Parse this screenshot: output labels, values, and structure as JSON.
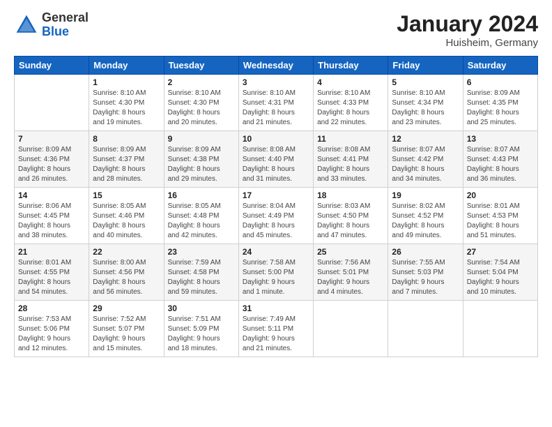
{
  "header": {
    "logo_general": "General",
    "logo_blue": "Blue",
    "main_title": "January 2024",
    "subtitle": "Huisheim, Germany"
  },
  "columns": [
    "Sunday",
    "Monday",
    "Tuesday",
    "Wednesday",
    "Thursday",
    "Friday",
    "Saturday"
  ],
  "rows": [
    [
      {
        "day": "",
        "info": ""
      },
      {
        "day": "1",
        "info": "Sunrise: 8:10 AM\nSunset: 4:30 PM\nDaylight: 8 hours\nand 19 minutes."
      },
      {
        "day": "2",
        "info": "Sunrise: 8:10 AM\nSunset: 4:30 PM\nDaylight: 8 hours\nand 20 minutes."
      },
      {
        "day": "3",
        "info": "Sunrise: 8:10 AM\nSunset: 4:31 PM\nDaylight: 8 hours\nand 21 minutes."
      },
      {
        "day": "4",
        "info": "Sunrise: 8:10 AM\nSunset: 4:33 PM\nDaylight: 8 hours\nand 22 minutes."
      },
      {
        "day": "5",
        "info": "Sunrise: 8:10 AM\nSunset: 4:34 PM\nDaylight: 8 hours\nand 23 minutes."
      },
      {
        "day": "6",
        "info": "Sunrise: 8:09 AM\nSunset: 4:35 PM\nDaylight: 8 hours\nand 25 minutes."
      }
    ],
    [
      {
        "day": "7",
        "info": "Sunrise: 8:09 AM\nSunset: 4:36 PM\nDaylight: 8 hours\nand 26 minutes."
      },
      {
        "day": "8",
        "info": "Sunrise: 8:09 AM\nSunset: 4:37 PM\nDaylight: 8 hours\nand 28 minutes."
      },
      {
        "day": "9",
        "info": "Sunrise: 8:09 AM\nSunset: 4:38 PM\nDaylight: 8 hours\nand 29 minutes."
      },
      {
        "day": "10",
        "info": "Sunrise: 8:08 AM\nSunset: 4:40 PM\nDaylight: 8 hours\nand 31 minutes."
      },
      {
        "day": "11",
        "info": "Sunrise: 8:08 AM\nSunset: 4:41 PM\nDaylight: 8 hours\nand 33 minutes."
      },
      {
        "day": "12",
        "info": "Sunrise: 8:07 AM\nSunset: 4:42 PM\nDaylight: 8 hours\nand 34 minutes."
      },
      {
        "day": "13",
        "info": "Sunrise: 8:07 AM\nSunset: 4:43 PM\nDaylight: 8 hours\nand 36 minutes."
      }
    ],
    [
      {
        "day": "14",
        "info": "Sunrise: 8:06 AM\nSunset: 4:45 PM\nDaylight: 8 hours\nand 38 minutes."
      },
      {
        "day": "15",
        "info": "Sunrise: 8:05 AM\nSunset: 4:46 PM\nDaylight: 8 hours\nand 40 minutes."
      },
      {
        "day": "16",
        "info": "Sunrise: 8:05 AM\nSunset: 4:48 PM\nDaylight: 8 hours\nand 42 minutes."
      },
      {
        "day": "17",
        "info": "Sunrise: 8:04 AM\nSunset: 4:49 PM\nDaylight: 8 hours\nand 45 minutes."
      },
      {
        "day": "18",
        "info": "Sunrise: 8:03 AM\nSunset: 4:50 PM\nDaylight: 8 hours\nand 47 minutes."
      },
      {
        "day": "19",
        "info": "Sunrise: 8:02 AM\nSunset: 4:52 PM\nDaylight: 8 hours\nand 49 minutes."
      },
      {
        "day": "20",
        "info": "Sunrise: 8:01 AM\nSunset: 4:53 PM\nDaylight: 8 hours\nand 51 minutes."
      }
    ],
    [
      {
        "day": "21",
        "info": "Sunrise: 8:01 AM\nSunset: 4:55 PM\nDaylight: 8 hours\nand 54 minutes."
      },
      {
        "day": "22",
        "info": "Sunrise: 8:00 AM\nSunset: 4:56 PM\nDaylight: 8 hours\nand 56 minutes."
      },
      {
        "day": "23",
        "info": "Sunrise: 7:59 AM\nSunset: 4:58 PM\nDaylight: 8 hours\nand 59 minutes."
      },
      {
        "day": "24",
        "info": "Sunrise: 7:58 AM\nSunset: 5:00 PM\nDaylight: 9 hours\nand 1 minute."
      },
      {
        "day": "25",
        "info": "Sunrise: 7:56 AM\nSunset: 5:01 PM\nDaylight: 9 hours\nand 4 minutes."
      },
      {
        "day": "26",
        "info": "Sunrise: 7:55 AM\nSunset: 5:03 PM\nDaylight: 9 hours\nand 7 minutes."
      },
      {
        "day": "27",
        "info": "Sunrise: 7:54 AM\nSunset: 5:04 PM\nDaylight: 9 hours\nand 10 minutes."
      }
    ],
    [
      {
        "day": "28",
        "info": "Sunrise: 7:53 AM\nSunset: 5:06 PM\nDaylight: 9 hours\nand 12 minutes."
      },
      {
        "day": "29",
        "info": "Sunrise: 7:52 AM\nSunset: 5:07 PM\nDaylight: 9 hours\nand 15 minutes."
      },
      {
        "day": "30",
        "info": "Sunrise: 7:51 AM\nSunset: 5:09 PM\nDaylight: 9 hours\nand 18 minutes."
      },
      {
        "day": "31",
        "info": "Sunrise: 7:49 AM\nSunset: 5:11 PM\nDaylight: 9 hours\nand 21 minutes."
      },
      {
        "day": "",
        "info": ""
      },
      {
        "day": "",
        "info": ""
      },
      {
        "day": "",
        "info": ""
      }
    ]
  ]
}
